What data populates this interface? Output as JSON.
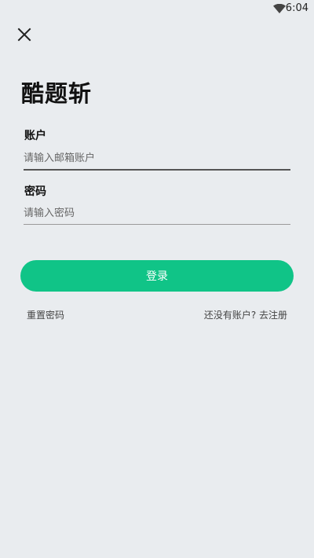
{
  "status_bar": {
    "time": "6:04",
    "icons": [
      "wifi-icon"
    ]
  },
  "header": {
    "close_icon": "close-icon"
  },
  "app": {
    "title": "酷题斩"
  },
  "form": {
    "account": {
      "label": "账户",
      "placeholder": "请输入邮箱账户",
      "value": ""
    },
    "password": {
      "label": "密码",
      "placeholder": "请输入密码",
      "value": ""
    },
    "login_label": "登录"
  },
  "links": {
    "reset_password": "重置密码",
    "register": "还没有账户? 去注册"
  },
  "colors": {
    "background": "#e9ecef",
    "accent": "#10c487"
  }
}
